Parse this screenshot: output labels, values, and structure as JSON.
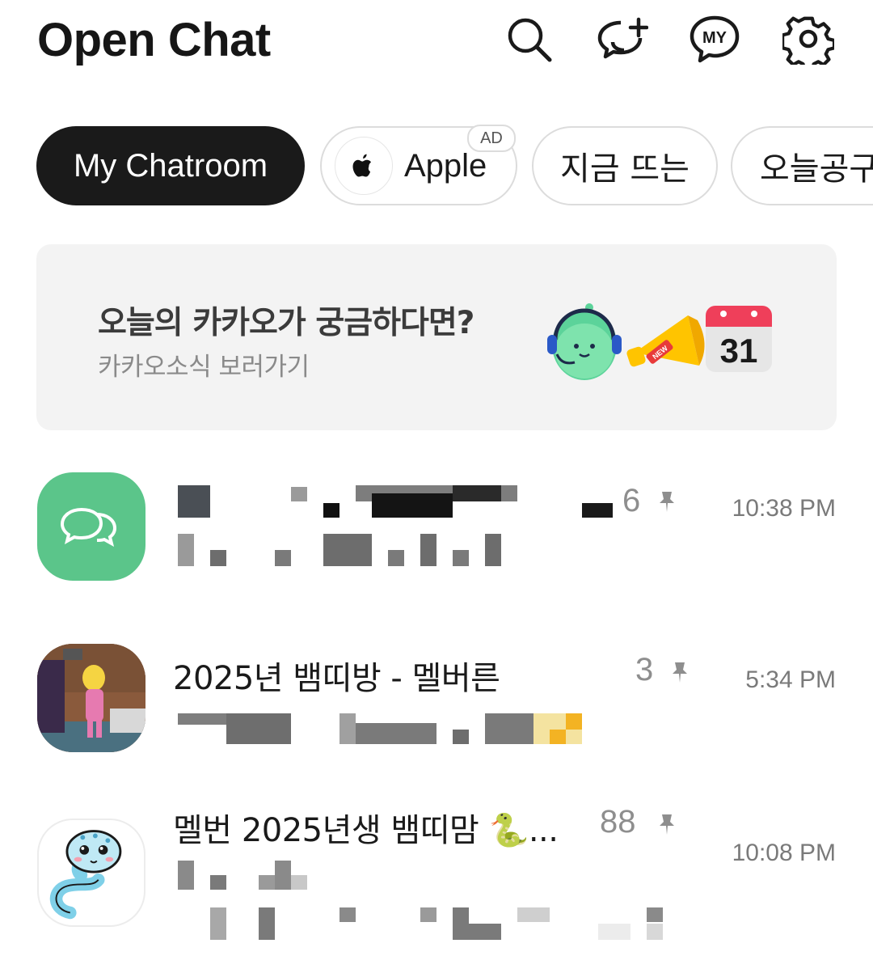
{
  "header": {
    "title": "Open Chat",
    "icons": [
      "search-icon",
      "new-chat-icon",
      "my-profile-icon",
      "settings-icon"
    ],
    "my_icon_label": "MY"
  },
  "chips": {
    "my_chatroom": "My Chatroom",
    "apple": "Apple",
    "ad_label": "AD",
    "trending": "지금 뜨는",
    "today": "오늘공구"
  },
  "banner": {
    "title": "오늘의 카카오가 궁금하다면?",
    "subtitle": "카카오소식 보러가기",
    "calendar_day": "31",
    "megaphone_label": "NEW"
  },
  "chat_rooms": [
    {
      "name": "",
      "count": "6",
      "time": "10:38 PM",
      "pinned": true
    },
    {
      "name": "2025년 뱀띠방 - 멜버른",
      "count": "3",
      "time": "5:34 PM",
      "pinned": true
    },
    {
      "name": "멜번 2025년생 뱀띠맘 🐍...",
      "count": "88",
      "time": "10:08 PM",
      "pinned": true
    }
  ],
  "colors": {
    "accent_dark": "#1a1a1a",
    "openchat_green": "#5bc58a",
    "muted": "#8e8e8e"
  }
}
